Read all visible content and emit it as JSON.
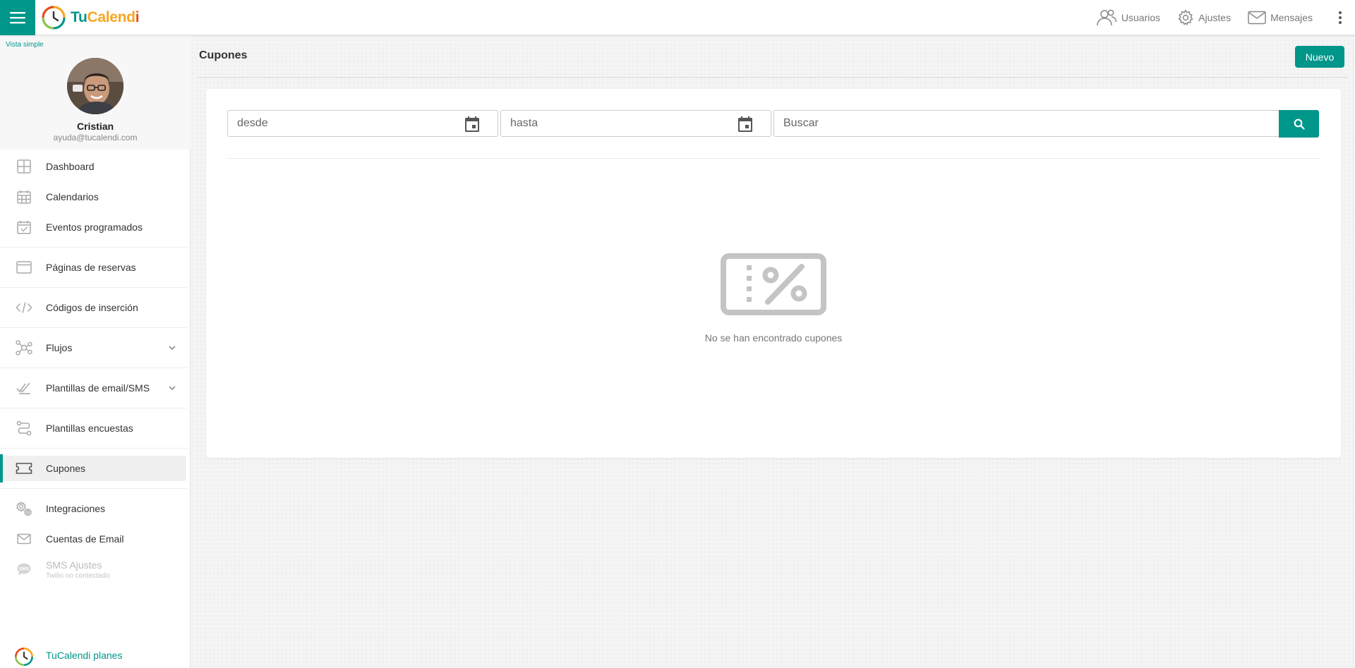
{
  "brand": {
    "part1": "Tu",
    "part2": "Calend",
    "part3": "i"
  },
  "header": {
    "actions": [
      {
        "label": "Usuarios",
        "icon": "users-icon"
      },
      {
        "label": "Ajustes",
        "icon": "gear-icon"
      },
      {
        "label": "Mensajes",
        "icon": "mail-icon"
      }
    ]
  },
  "sidebar": {
    "view_toggle": "Vista simple",
    "profile": {
      "name": "Cristian",
      "email": "ayuda@tucalendi.com"
    },
    "items": [
      {
        "label": "Dashboard",
        "icon": "dashboard-icon"
      },
      {
        "label": "Calendarios",
        "icon": "calendar-icon"
      },
      {
        "label": "Eventos programados",
        "icon": "calendar-check-icon"
      },
      {
        "label": "Páginas de reservas",
        "icon": "browser-window-icon"
      },
      {
        "label": "Códigos de inserción",
        "icon": "code-icon"
      },
      {
        "label": "Flujos",
        "icon": "workflow-icon"
      },
      {
        "label": "Plantillas de email/SMS",
        "icon": "double-check-icon"
      },
      {
        "label": "Plantillas encuestas",
        "icon": "route-icon"
      },
      {
        "label": "Cupones",
        "icon": "ticket-icon",
        "active": true
      },
      {
        "label": "Integraciones",
        "icon": "gears-icon"
      },
      {
        "label": "Cuentas de Email",
        "icon": "envelope-icon"
      },
      {
        "label": "SMS Ajustes",
        "sublabel": "Twilio no contectado",
        "icon": "sms-icon",
        "disabled": true
      }
    ],
    "plans_link": "TuCalendi planes"
  },
  "main": {
    "title": "Cupones",
    "new_button": "Nuevo",
    "filters": {
      "from_placeholder": "desde",
      "to_placeholder": "hasta",
      "search_placeholder": "Buscar"
    },
    "empty_state": "No se han encontrado cupones"
  },
  "colors": {
    "accent": "#00968a",
    "logo_orange": "#f5a623",
    "logo_red": "#e64a19"
  }
}
